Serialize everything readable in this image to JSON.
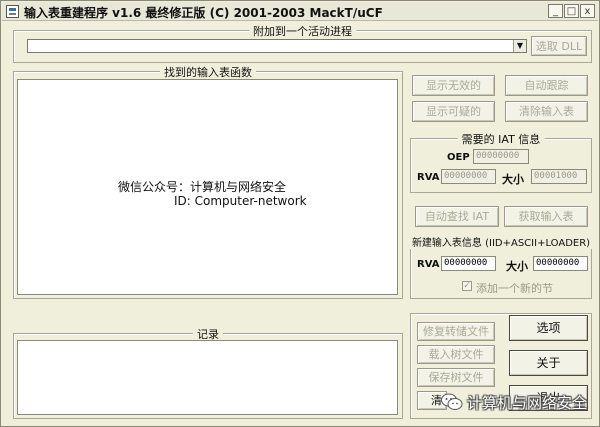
{
  "window": {
    "title": "输入表重建程序 v1.6 最终修正版 (C) 2001-2003 MackT/uCF",
    "controls": {
      "minimize": "_",
      "maximize": "□",
      "close": "x"
    }
  },
  "attach": {
    "group_label": "附加到一个活动进程",
    "process_value": "",
    "dropdown_arrow": "▼",
    "pick_dll_label": "选取 DLL"
  },
  "imports": {
    "group_label": "找到的输入表函数",
    "content_lines": [
      "微信公众号：计算机与网络安全",
      "ID: Computer-network"
    ]
  },
  "tree_buttons": {
    "show_invalid": "显示无效的",
    "auto_trace": "自动跟踪",
    "show_suspect": "显示可疑的",
    "clear_imports": "清除输入表"
  },
  "iat_info": {
    "group_label": "需要的 IAT 信息",
    "oep_label": "OEP",
    "oep_value": "00000000",
    "rva_label": "RVA",
    "rva_value": "00000000",
    "size_label": "大小",
    "size_value": "00001000"
  },
  "iat_buttons": {
    "iat_autosearch": "自动查找 IAT",
    "get_imports": "获取输入表"
  },
  "new_import": {
    "group_label": "新建输入表信息 (IID+ASCII+LOADER)",
    "rva_label": "RVA",
    "rva_value": "00000000",
    "size_label": "大小",
    "size_value": "00000000",
    "add_section_label": "添加一个新的节",
    "add_section_checked": true,
    "check_mark": "✓"
  },
  "log": {
    "group_label": "记录"
  },
  "actions": {
    "fix_dump": "修复转储文件",
    "load_tree": "载入树文件",
    "save_tree": "保存树文件",
    "options": "选项",
    "about": "关于",
    "exit": "退出",
    "clear_log_partial": "清"
  },
  "watermark": {
    "text": "计算机与网络安全",
    "icon": "wechat-icon"
  }
}
